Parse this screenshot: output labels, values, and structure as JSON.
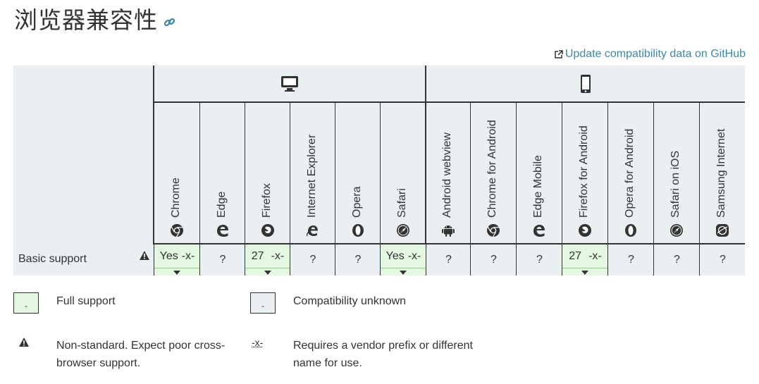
{
  "heading": {
    "title": "浏览器兼容性"
  },
  "update_link": {
    "label": "Update compatibility data on GitHub"
  },
  "platforms": {
    "desktop": "desktop-icon",
    "mobile": "mobile-icon"
  },
  "browsers": [
    {
      "name": "Chrome",
      "icon": "chrome-icon"
    },
    {
      "name": "Edge",
      "icon": "edge-icon"
    },
    {
      "name": "Firefox",
      "icon": "firefox-icon"
    },
    {
      "name": "Internet Explorer",
      "icon": "ie-icon"
    },
    {
      "name": "Opera",
      "icon": "opera-icon"
    },
    {
      "name": "Safari",
      "icon": "safari-icon"
    },
    {
      "name": "Android webview",
      "icon": "android-icon"
    },
    {
      "name": "Chrome for Android",
      "icon": "chrome-icon"
    },
    {
      "name": "Edge Mobile",
      "icon": "edge-icon"
    },
    {
      "name": "Firefox for Android",
      "icon": "firefox-icon"
    },
    {
      "name": "Opera for Android",
      "icon": "opera-icon"
    },
    {
      "name": "Safari on iOS",
      "icon": "safari-icon"
    },
    {
      "name": "Samsung Internet",
      "icon": "samsung-icon"
    }
  ],
  "rows": [
    {
      "feature": "Basic support",
      "flag_icon": "warning-icon",
      "values": [
        "Yes",
        "?",
        "27",
        "?",
        "?",
        "Yes",
        "?",
        "?",
        "?",
        "27",
        "?",
        "?",
        "?"
      ],
      "prefix": [
        "-x-",
        "",
        "-x-",
        "",
        "",
        "-x-",
        "",
        "",
        "",
        "-x-",
        "",
        "",
        ""
      ],
      "support": [
        "full",
        "unknown",
        "full",
        "unknown",
        "unknown",
        "full",
        "unknown",
        "unknown",
        "unknown",
        "full",
        "unknown",
        "unknown",
        "unknown"
      ]
    }
  ],
  "legend": {
    "full_support": "Full support",
    "compat_unknown": "Compatibility unknown",
    "non_standard": "Non-standard. Expect poor cross-browser support.",
    "prefix_symbol": "-x-",
    "prefix_text": "Requires a vendor prefix or different name for use.",
    "box_mark": "-"
  },
  "colors": {
    "accent": "#3f87a6",
    "full_bg": "#e4f8e1",
    "header_bg": "#eaeff2"
  }
}
